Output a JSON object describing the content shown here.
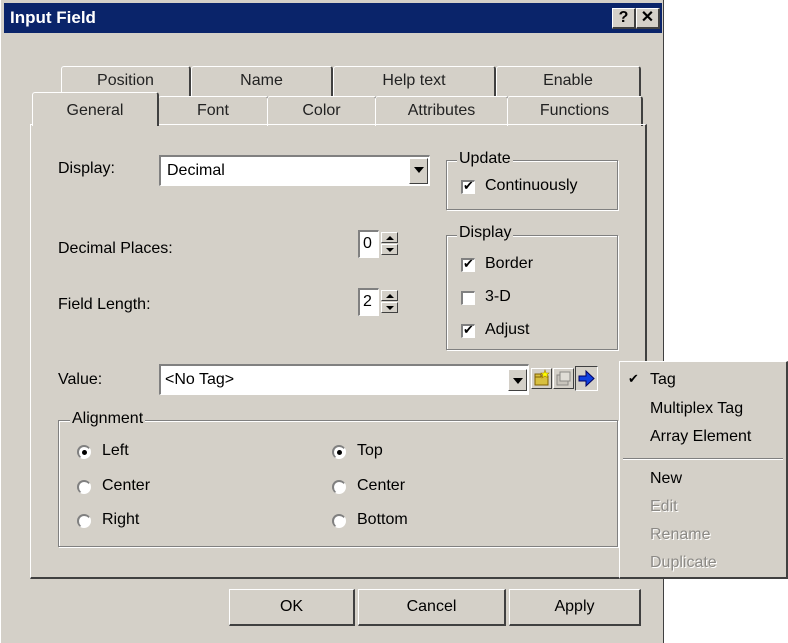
{
  "window": {
    "title": "Input Field",
    "help_label": "?",
    "close_label": "✕"
  },
  "tabs_back": [
    "Position",
    "Name",
    "Help text",
    "Enable"
  ],
  "tabs_front": [
    "General",
    "Font",
    "Color",
    "Attributes",
    "Functions"
  ],
  "general": {
    "display_label": "Display:",
    "display_value": "Decimal",
    "decimal_places_label": "Decimal Places:",
    "decimal_places_value": "0",
    "field_length_label": "Field Length:",
    "field_length_value": "2",
    "value_label": "Value:",
    "value_value": "<No Tag>"
  },
  "update_group": {
    "title": "Update",
    "continuously_label": "Continuously",
    "continuously_checked": true
  },
  "display_group": {
    "title": "Display",
    "border_label": "Border",
    "border_checked": true,
    "threed_label": "3-D",
    "threed_checked": false,
    "adjust_label": "Adjust",
    "adjust_checked": true
  },
  "alignment": {
    "title": "Alignment",
    "horizontal": [
      "Left",
      "Center",
      "Right"
    ],
    "horizontal_selected": "Left",
    "vertical": [
      "Top",
      "Center",
      "Bottom"
    ],
    "vertical_selected": "Top"
  },
  "buttons": {
    "ok": "OK",
    "cancel": "Cancel",
    "apply": "Apply"
  },
  "menu": {
    "checked_mark": "✔",
    "items": [
      {
        "label": "Tag",
        "checked": true,
        "enabled": true
      },
      {
        "label": "Multiplex Tag",
        "checked": false,
        "enabled": true
      },
      {
        "label": "Array Element",
        "checked": false,
        "enabled": true
      },
      {
        "label": "New",
        "checked": false,
        "enabled": true
      },
      {
        "label": "Edit",
        "checked": false,
        "enabled": false
      },
      {
        "label": "Rename",
        "checked": false,
        "enabled": false
      },
      {
        "label": "Duplicate",
        "checked": false,
        "enabled": false
      }
    ]
  },
  "icons": {
    "select_tag": "folder-star-icon",
    "tag_dialog": "tag-edit-icon",
    "arrow": "blue-arrow-right-icon"
  },
  "colors": {
    "titlebar": "#0a246a",
    "face": "#d4d0c8",
    "field": "#ffffff"
  }
}
